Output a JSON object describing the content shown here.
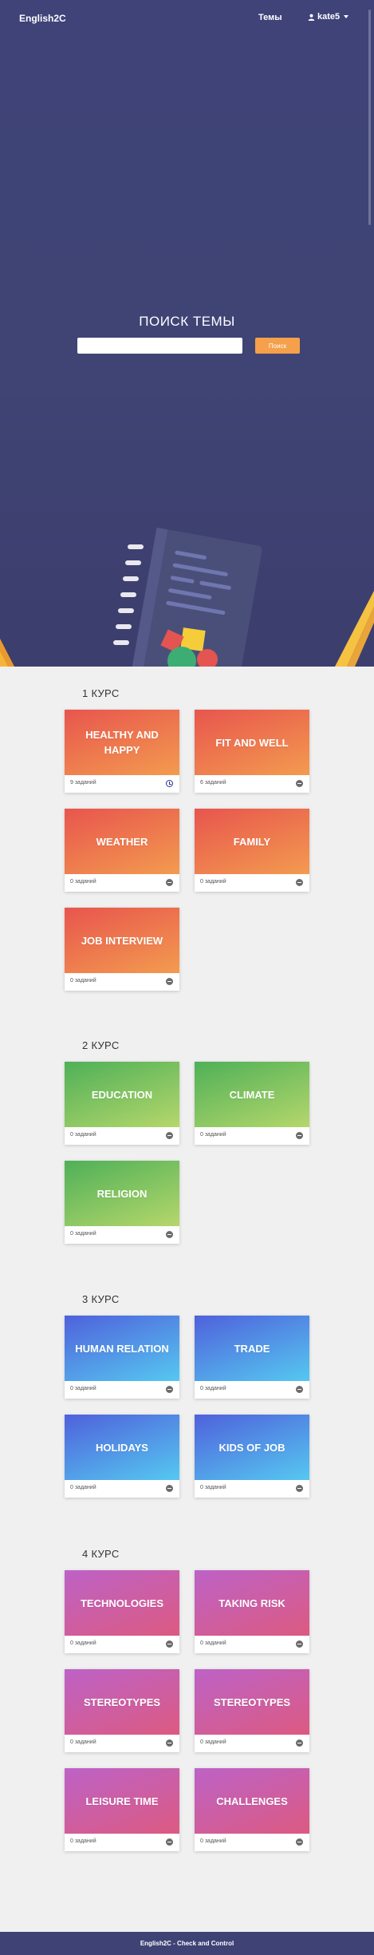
{
  "navbar": {
    "brand": "English2C",
    "topics_link": "Темы",
    "user_name": "kate5"
  },
  "search": {
    "title": "ПОИСК ТЕМЫ",
    "placeholder": "",
    "button_label": "Поиск"
  },
  "courses": [
    {
      "heading": "1 КУРС",
      "cards": [
        {
          "title": "HEALTHY AND HAPPY",
          "count": "9 заданий",
          "status": "clock"
        },
        {
          "title": "FIT AND WELL",
          "count": "6 заданий",
          "status": "minus"
        },
        {
          "title": "WEATHER",
          "count": "0 заданий",
          "status": "minus"
        },
        {
          "title": "FAMILY",
          "count": "0 заданий",
          "status": "minus"
        },
        {
          "title": "JOB INTERVIEW",
          "count": "0 заданий",
          "status": "minus"
        }
      ]
    },
    {
      "heading": "2 КУРС",
      "cards": [
        {
          "title": "EDUCATION",
          "count": "0 заданий",
          "status": "minus"
        },
        {
          "title": "CLIMATE",
          "count": "0 заданий",
          "status": "minus"
        },
        {
          "title": "RELIGION",
          "count": "0 заданий",
          "status": "minus"
        }
      ]
    },
    {
      "heading": "3 КУРС",
      "cards": [
        {
          "title": "HUMAN RELATION",
          "count": "0 заданий",
          "status": "minus"
        },
        {
          "title": "TRADE",
          "count": "0 заданий",
          "status": "minus"
        },
        {
          "title": "HOLIDAYS",
          "count": "0 заданий",
          "status": "minus"
        },
        {
          "title": "KIDS OF JOB",
          "count": "0 заданий",
          "status": "minus"
        }
      ]
    },
    {
      "heading": "4 КУРС",
      "cards": [
        {
          "title": "TECHNOLOGIES",
          "count": "0 заданий",
          "status": "minus"
        },
        {
          "title": "TAKING RISK",
          "count": "0 заданий",
          "status": "minus"
        },
        {
          "title": "STEREOTYPES",
          "count": "0 заданий",
          "status": "minus"
        },
        {
          "title": "STEREOTYPES",
          "count": "0 заданий",
          "status": "minus"
        },
        {
          "title": "LEISURE TIME",
          "count": "0 заданий",
          "status": "minus"
        },
        {
          "title": "CHALLENGES",
          "count": "0 заданий",
          "status": "minus"
        }
      ]
    }
  ],
  "footer": {
    "text": "English2C - Check and Control"
  },
  "colors": {
    "hero": "#3f4378",
    "search_button": "#f5a04a",
    "course1": "#e8554e",
    "course2": "#4fb058",
    "course3": "#4f61dc",
    "course4": "#bd62c7",
    "footer": "#3f4275"
  }
}
